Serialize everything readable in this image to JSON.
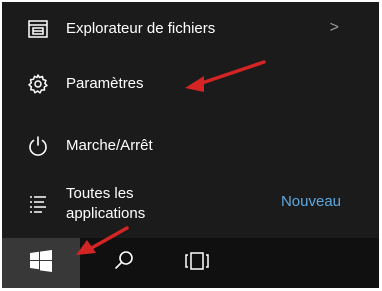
{
  "start_menu": {
    "items": [
      {
        "label": "Explorateur de fichiers",
        "icon": "file-explorer-icon",
        "chevron": ">"
      },
      {
        "label": "Paramètres",
        "icon": "gear-icon"
      },
      {
        "label": "Marche/Arrêt",
        "icon": "power-icon"
      },
      {
        "label": "Toutes les applications",
        "icon": "all-apps-icon",
        "badge": "Nouveau"
      }
    ]
  },
  "taskbar": {
    "buttons": [
      {
        "icon": "windows-logo-icon"
      },
      {
        "icon": "search-icon"
      },
      {
        "icon": "task-view-icon"
      }
    ]
  },
  "colors": {
    "menu_background": "#1b1b1b",
    "taskbar_background": "#101010",
    "start_button_highlight": "#383838",
    "badge_accent": "#5fa8e0",
    "annotation_arrow": "#d42424"
  }
}
